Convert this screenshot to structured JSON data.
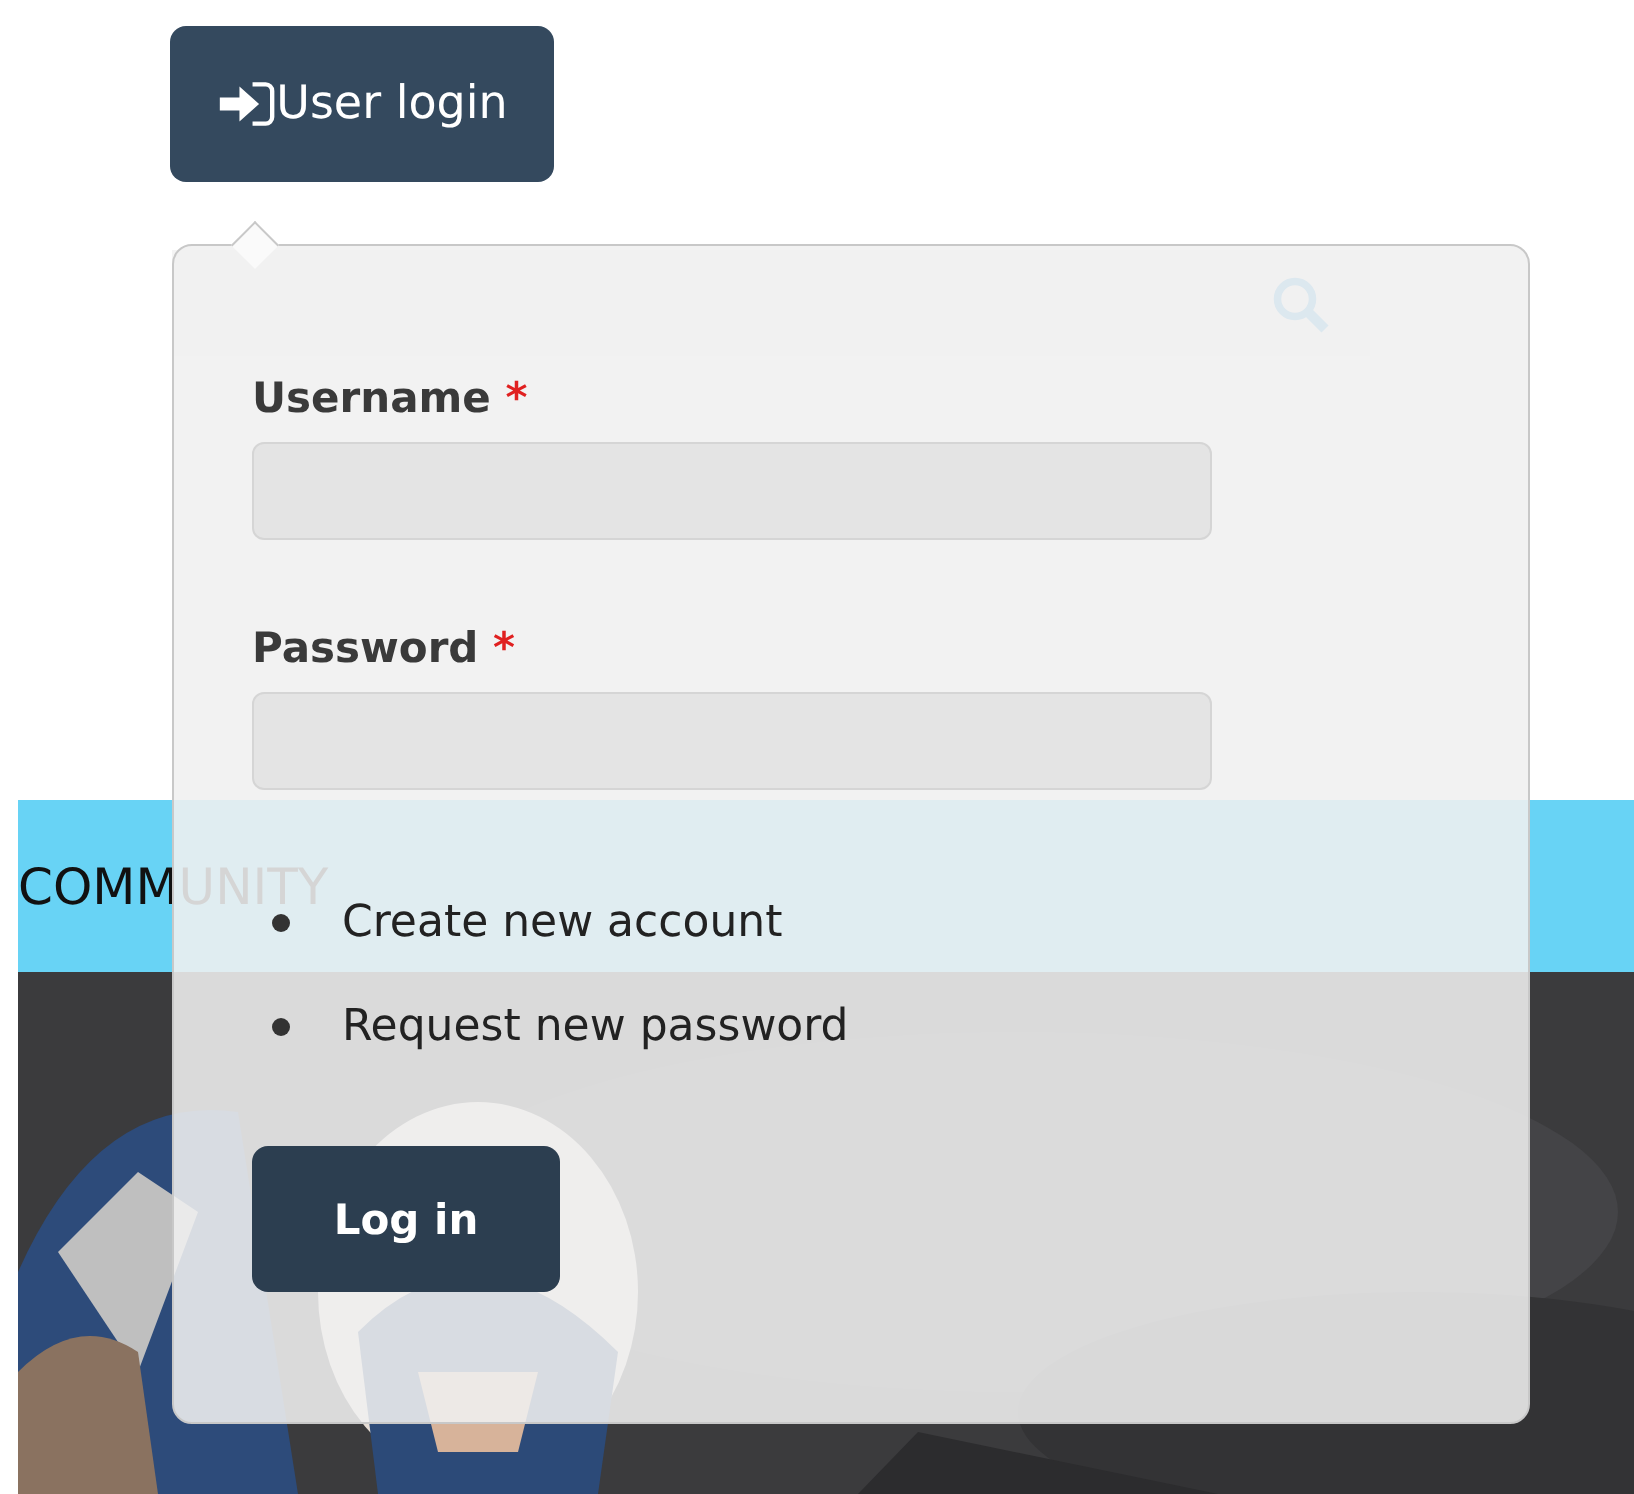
{
  "login_button": {
    "label": "User login"
  },
  "background": {
    "menu": {
      "label": "COMMUNITY"
    }
  },
  "popover": {
    "fields": [
      {
        "label": "Username",
        "required_mark": "*"
      },
      {
        "label": "Password",
        "required_mark": "*"
      }
    ],
    "links": [
      "Create new account",
      "Request new password"
    ],
    "submit": "Log in"
  }
}
